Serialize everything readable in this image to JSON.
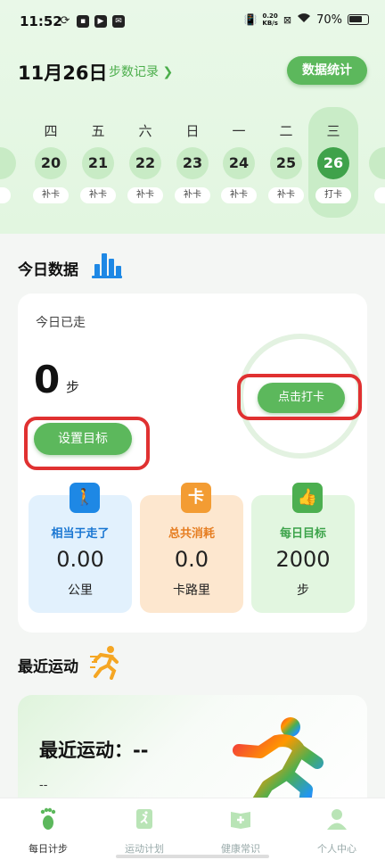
{
  "status": {
    "time": "11:52",
    "net_speed_value": "0.20",
    "net_speed_unit": "KB/s",
    "battery": "70%"
  },
  "header": {
    "date": "11月26日",
    "step_record": "步数记录 ❯",
    "stats_button": "数据统计"
  },
  "week": [
    {
      "weekday": "四",
      "day": "20",
      "tag": "补卡",
      "selected": false
    },
    {
      "weekday": "五",
      "day": "21",
      "tag": "补卡",
      "selected": false
    },
    {
      "weekday": "六",
      "day": "22",
      "tag": "补卡",
      "selected": false
    },
    {
      "weekday": "日",
      "day": "23",
      "tag": "补卡",
      "selected": false
    },
    {
      "weekday": "一",
      "day": "24",
      "tag": "补卡",
      "selected": false
    },
    {
      "weekday": "二",
      "day": "25",
      "tag": "补卡",
      "selected": false
    },
    {
      "weekday": "三",
      "day": "26",
      "tag": "打卡",
      "selected": true
    }
  ],
  "today": {
    "section_title": "今日数据",
    "walked_label": "今日已走",
    "steps": "0",
    "steps_unit": "步",
    "goal_button": "设置目标",
    "checkin_button": "点击打卡",
    "stats": [
      {
        "label": "相当于走了",
        "value": "0.00",
        "unit": "公里",
        "icon": "walking-person-icon",
        "color": "#1976d2",
        "bg": "#e2f1fd",
        "icon_bg": "#1e88e5",
        "glyph": "🚶"
      },
      {
        "label": "总共消耗",
        "value": "0.0",
        "unit": "卡路里",
        "icon": "calorie-card-icon",
        "color": "#e67e22",
        "bg": "#fde7cf",
        "icon_bg": "#f39c33",
        "glyph": "卡"
      },
      {
        "label": "每日目标",
        "value": "2000",
        "unit": "步",
        "icon": "thumbs-up-icon",
        "color": "#3ca34a",
        "bg": "#e2f6e0",
        "icon_bg": "#4caf50",
        "glyph": "👍"
      }
    ]
  },
  "recent": {
    "section_title": "最近运动",
    "headline": "最近运动：--",
    "sub": "--"
  },
  "nav": [
    {
      "label": "每日计步",
      "icon": "footprint-icon",
      "active": true
    },
    {
      "label": "运动计划",
      "icon": "plan-book-icon",
      "active": false
    },
    {
      "label": "健康常识",
      "icon": "health-book-icon",
      "active": false
    },
    {
      "label": "个人中心",
      "icon": "person-icon",
      "active": false
    }
  ],
  "colors": {
    "accent": "#5cb85c",
    "highlight": "#e03131"
  }
}
